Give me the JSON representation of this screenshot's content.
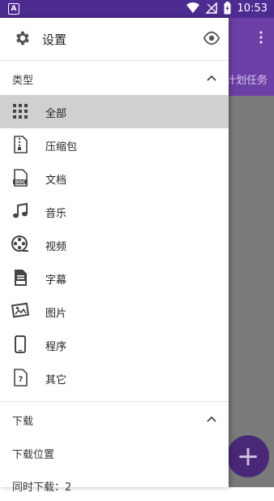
{
  "status_bar": {
    "time": "10:53",
    "badge": "A",
    "battery_badge": "⚡"
  },
  "app": {
    "tab_text": "计划任务",
    "fab_label": "+"
  },
  "drawer": {
    "header_title": "设置",
    "category_section": "类型",
    "items": [
      {
        "label": "全部",
        "icon": "grid-icon"
      },
      {
        "label": "压缩包",
        "icon": "zip-file-icon"
      },
      {
        "label": "文档",
        "icon": "doc-file-icon"
      },
      {
        "label": "音乐",
        "icon": "music-note-icon"
      },
      {
        "label": "视频",
        "icon": "film-reel-icon"
      },
      {
        "label": "字幕",
        "icon": "subtitle-file-icon"
      },
      {
        "label": "图片",
        "icon": "image-icon"
      },
      {
        "label": "程序",
        "icon": "phone-icon"
      },
      {
        "label": "其它",
        "icon": "unknown-file-icon"
      }
    ],
    "download_section": "下载",
    "download_location": "下载位置",
    "concurrent_downloads": "同时下载：2"
  },
  "colors": {
    "status_bar": "#4d2c91",
    "app_bar": "#6b3fa5",
    "scrim": "#7a7a7a",
    "active_item": "#d0d0d0",
    "fab": "#4a2878"
  }
}
